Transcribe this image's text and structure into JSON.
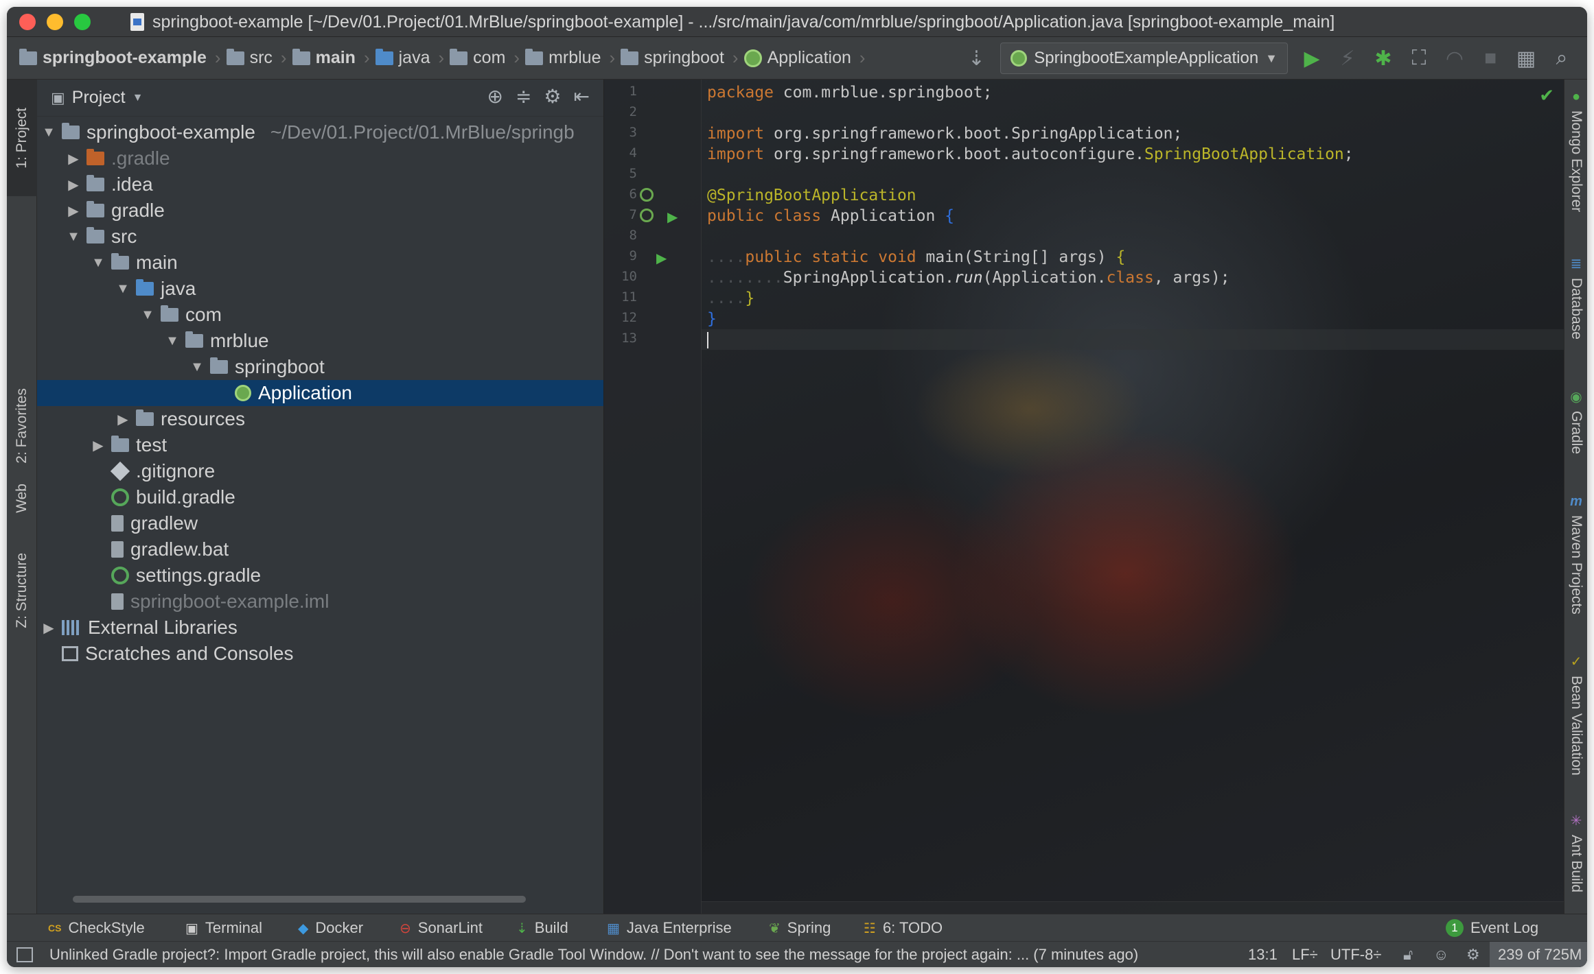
{
  "window": {
    "title": "springboot-example [~/Dev/01.Project/01.MrBlue/springboot-example] - .../src/main/java/com/mrblue/springboot/Application.java [springboot-example_main]"
  },
  "breadcrumbs": [
    {
      "label": "springboot-example",
      "icon": "folder-icon"
    },
    {
      "label": "src",
      "icon": "folder-icon"
    },
    {
      "label": "main",
      "icon": "folder-icon"
    },
    {
      "label": "java",
      "icon": "folder-icon"
    },
    {
      "label": "com",
      "icon": "folder-icon"
    },
    {
      "label": "mrblue",
      "icon": "folder-icon"
    },
    {
      "label": "springboot",
      "icon": "folder-icon"
    },
    {
      "label": "Application",
      "icon": "spring-class-icon"
    }
  ],
  "toolbar": {
    "run_config": "SpringbootExampleApplication"
  },
  "left_stripe": {
    "project_tab": "1: Project",
    "favorites_tab": "2: Favorites",
    "web_tab": "Web",
    "structure_tab": "Z: Structure"
  },
  "project_panel": {
    "header": "Project",
    "tree": [
      {
        "label": "springboot-example",
        "path": "~/Dev/01.Project/01.MrBlue/springb"
      },
      {
        "label": ".gradle"
      },
      {
        "label": ".idea"
      },
      {
        "label": "gradle"
      },
      {
        "label": "src"
      },
      {
        "label": "main"
      },
      {
        "label": "java"
      },
      {
        "label": "com"
      },
      {
        "label": "mrblue"
      },
      {
        "label": "springboot"
      },
      {
        "label": "Application"
      },
      {
        "label": "resources"
      },
      {
        "label": "test"
      },
      {
        "label": ".gitignore"
      },
      {
        "label": "build.gradle"
      },
      {
        "label": "gradlew"
      },
      {
        "label": "gradlew.bat"
      },
      {
        "label": "settings.gradle"
      },
      {
        "label": "springboot-example.iml"
      },
      {
        "label": "External Libraries"
      },
      {
        "label": "Scratches and Consoles"
      }
    ]
  },
  "editor": {
    "line_numbers": [
      "1",
      "2",
      "3",
      "4",
      "5",
      "6",
      "7",
      "8",
      "9",
      "10",
      "11",
      "12",
      "13"
    ],
    "code": {
      "l1_kw": "package",
      "l1_rest": " com.mrblue.springboot;",
      "l3_kw": "import",
      "l3_rest": " org.springframework.boot.SpringApplication;",
      "l4_kw": "import",
      "l4_rest": " org.springframework.boot.autoconfigure.",
      "l4_ann": "SpringBootApplication",
      "l4_end": ";",
      "l6_ann": "@SpringBootApplication",
      "l7_kw": "public class",
      "l7_rest": " Application ",
      "l7_brace": "{",
      "l9_ws": "....",
      "l9_kw": "public static void",
      "l9_rest": " main(String[] args) ",
      "l9_brace": "{",
      "l10_ws": "........",
      "l10_a": "SpringApplication.",
      "l10_run": "run",
      "l10_b": "(Application.",
      "l10_kw": "class",
      "l10_c": ", args);",
      "l11_ws": "....",
      "l11_brace": "}",
      "l12_brace": "}"
    }
  },
  "right_stripe": {
    "tabs": [
      "Mongo Explorer",
      "Database",
      "Gradle",
      "Maven Projects",
      "Bean Validation",
      "Ant Build"
    ]
  },
  "bottom_tabs": {
    "checkstyle": "CheckStyle",
    "terminal": "Terminal",
    "docker": "Docker",
    "sonarlint": "SonarLint",
    "build": "Build",
    "java_enterprise": "Java Enterprise",
    "spring": "Spring",
    "todo": "6: TODO",
    "event_log": "Event Log",
    "event_log_count": "1"
  },
  "status_bar": {
    "message": "Unlinked Gradle project?: Import Gradle project, this will also enable Gradle Tool Window. // Don't want to see the message for the project again: ... (7 minutes ago)",
    "position": "13:1",
    "line_sep": "LF÷",
    "encoding": "UTF-8÷",
    "memory": "239 of 725M"
  }
}
